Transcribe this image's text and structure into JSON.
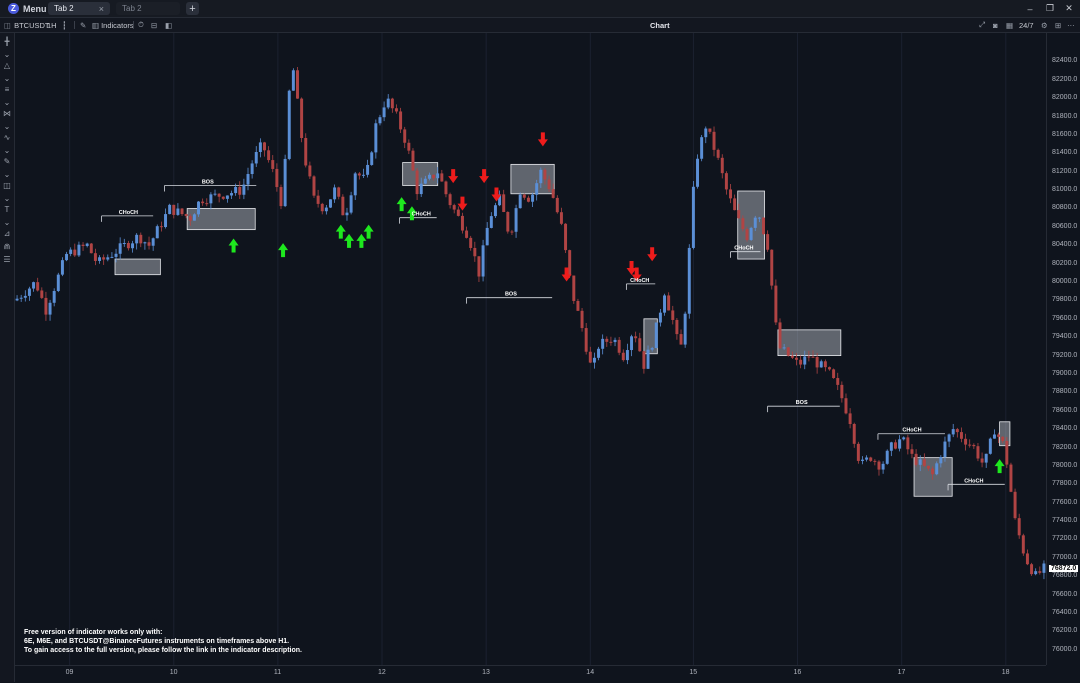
{
  "topbar": {
    "menu_label": "Menu",
    "logo_text": "Z",
    "tabs": [
      {
        "label": "Tab 2",
        "active": true
      },
      {
        "label": "Tab 2",
        "active": false
      }
    ],
    "add_tab_label": "+",
    "window_buttons": {
      "minimize": "–",
      "restore": "❐",
      "close": "✕"
    }
  },
  "toolbar": {
    "symbol": "BTCUSDT",
    "interval": "1H",
    "indicators_label": "Indicators",
    "center_title": "Chart",
    "session_label": "24/7"
  },
  "sidebar_icons": [
    "crosshair-icon",
    "chevron-down-icon",
    "triangle-tool-icon",
    "chevron-down-icon",
    "lines-tool-icon",
    "chevron-down-icon",
    "pattern-tool-icon",
    "chevron-down-icon",
    "curve-tool-icon",
    "chevron-down-icon",
    "brush-tool-icon",
    "chevron-down-icon",
    "shapes-tool-icon",
    "chevron-down-icon",
    "text-tool-icon",
    "chevron-down-icon",
    "measure-tool-icon",
    "magnet-icon",
    "layers-icon"
  ],
  "notice": [
    "Free version of indicator works only with:",
    "6E, M6E, and BTCUSDT@BinanceFutures instruments on timeframes above H1.",
    "To gain access to the full version, please follow the link in the indicator description."
  ],
  "chart_data": {
    "type": "candlestick",
    "symbol": "BTCUSDT",
    "timeframe": "1H",
    "ylim": [
      75900,
      82600
    ],
    "yticks": [
      82400,
      82200,
      82000,
      81800,
      81600,
      81400,
      81200,
      81000,
      80800,
      80600,
      80400,
      80200,
      80000,
      79800,
      79600,
      79400,
      79200,
      79000,
      78800,
      78600,
      78400,
      78200,
      78000,
      77800,
      77600,
      77400,
      77200,
      77000,
      76800,
      76600,
      76400,
      76200,
      76000
    ],
    "ytick_labels": [
      "82400.0",
      "82200.0",
      "82000.0",
      "81800.0",
      "81600.0",
      "81400.0",
      "81200.0",
      "81000.0",
      "80800.0",
      "80600.0",
      "80400.0",
      "80200.0",
      "80000.0",
      "79800.0",
      "79600.0",
      "79400.0",
      "79200.0",
      "79000.0",
      "78800.0",
      "78600.0",
      "78400.0",
      "78200.0",
      "78000.0",
      "77800.0",
      "77600.0",
      "77400.0",
      "77200.0",
      "77000.0",
      "76800.0",
      "76600.0",
      "76400.0",
      "76200.0",
      "76000.0"
    ],
    "xlim": [
      0,
      100
    ],
    "xticks": [
      {
        "label": "09",
        "x": 5.3
      },
      {
        "label": "10",
        "x": 15.4
      },
      {
        "label": "11",
        "x": 25.5
      },
      {
        "label": "12",
        "x": 35.6
      },
      {
        "label": "13",
        "x": 45.7
      },
      {
        "label": "14",
        "x": 55.8
      },
      {
        "label": "15",
        "x": 65.8
      },
      {
        "label": "16",
        "x": 75.9
      },
      {
        "label": "17",
        "x": 86.0
      },
      {
        "label": "18",
        "x": 96.1
      }
    ],
    "last_price": "76872.0",
    "up_color": "#5b8fd6",
    "down_color": "#b04444",
    "price_path": [
      [
        0,
        79800
      ],
      [
        2,
        80000
      ],
      [
        3,
        79700
      ],
      [
        5,
        80300
      ],
      [
        7,
        80400
      ],
      [
        8,
        80200
      ],
      [
        10,
        80350
      ],
      [
        12,
        80500
      ],
      [
        13,
        80400
      ],
      [
        14,
        80600
      ],
      [
        15,
        80800
      ],
      [
        17,
        80700
      ],
      [
        18,
        80900
      ],
      [
        20,
        80950
      ],
      [
        22,
        81000
      ],
      [
        23,
        81300
      ],
      [
        24,
        81500
      ],
      [
        25,
        81200
      ],
      [
        26,
        80800
      ],
      [
        26.5,
        82000
      ],
      [
        27,
        82300
      ],
      [
        28,
        81400
      ],
      [
        29,
        80900
      ],
      [
        30,
        80800
      ],
      [
        31,
        81000
      ],
      [
        32,
        80700
      ],
      [
        33,
        81200
      ],
      [
        34,
        81100
      ],
      [
        35,
        81700
      ],
      [
        36,
        82000
      ],
      [
        37,
        81800
      ],
      [
        38,
        81500
      ],
      [
        39,
        81000
      ],
      [
        40,
        81100
      ],
      [
        41,
        81200
      ],
      [
        42,
        80900
      ],
      [
        43,
        80700
      ],
      [
        44,
        80500
      ],
      [
        45,
        80100
      ],
      [
        46,
        80700
      ],
      [
        47,
        80900
      ],
      [
        48,
        80500
      ],
      [
        49,
        81000
      ],
      [
        50,
        80900
      ],
      [
        51,
        81200
      ],
      [
        52,
        81000
      ],
      [
        53,
        80600
      ],
      [
        54,
        79900
      ],
      [
        55,
        79500
      ],
      [
        56,
        79000
      ],
      [
        56.5,
        79300
      ],
      [
        58,
        79400
      ],
      [
        59,
        79200
      ],
      [
        60,
        79500
      ],
      [
        61,
        79100
      ],
      [
        62,
        79400
      ],
      [
        63,
        79900
      ],
      [
        64,
        79500
      ],
      [
        64.5,
        79200
      ],
      [
        65,
        79700
      ],
      [
        66,
        81300
      ],
      [
        67,
        81700
      ],
      [
        68,
        81400
      ],
      [
        69,
        81000
      ],
      [
        70,
        80700
      ],
      [
        71,
        80500
      ],
      [
        72,
        80800
      ],
      [
        73,
        80400
      ],
      [
        74,
        79300
      ],
      [
        75,
        79200
      ],
      [
        76,
        79100
      ],
      [
        77,
        79200
      ],
      [
        78,
        79100
      ],
      [
        79,
        79000
      ],
      [
        80,
        78800
      ],
      [
        81,
        78500
      ],
      [
        82,
        78000
      ],
      [
        83,
        78100
      ],
      [
        84,
        78000
      ],
      [
        85,
        78200
      ],
      [
        86,
        78300
      ],
      [
        87,
        78100
      ],
      [
        88,
        78000
      ],
      [
        89,
        77900
      ],
      [
        90,
        78200
      ],
      [
        91,
        78400
      ],
      [
        92,
        78300
      ],
      [
        93,
        78200
      ],
      [
        94,
        78000
      ],
      [
        95,
        78400
      ],
      [
        96,
        78200
      ],
      [
        97,
        77400
      ],
      [
        98,
        77000
      ],
      [
        99,
        76800
      ],
      [
        100,
        76900
      ]
    ],
    "markers": {
      "buy": [
        [
          26,
          80500
        ],
        [
          31.6,
          80700
        ],
        [
          32.4,
          80600
        ],
        [
          33.6,
          80600
        ],
        [
          34.3,
          80700
        ],
        [
          37.5,
          81000
        ],
        [
          38.5,
          80900
        ],
        [
          21.2,
          80550
        ],
        [
          95.5,
          78150
        ]
      ],
      "sell": [
        [
          42.5,
          81000
        ],
        [
          43.4,
          80700
        ],
        [
          45.5,
          81000
        ],
        [
          46.7,
          80800
        ],
        [
          51.2,
          81400
        ],
        [
          53.5,
          79930
        ],
        [
          59.8,
          80000
        ],
        [
          60.3,
          79930
        ],
        [
          61.8,
          80150
        ]
      ]
    },
    "boxes": [
      {
        "x0": 9.7,
        "x1": 14.1,
        "y0": 80250,
        "y1": 80080,
        "label": ""
      },
      {
        "x0": 16.7,
        "x1": 23.3,
        "y0": 80800,
        "y1": 80570,
        "label": ""
      },
      {
        "x0": 37.6,
        "x1": 41.0,
        "y0": 81300,
        "y1": 81050,
        "label": ""
      },
      {
        "x0": 48.1,
        "x1": 52.3,
        "y0": 81280,
        "y1": 80960,
        "label": ""
      },
      {
        "x0": 61.0,
        "x1": 62.3,
        "y0": 79600,
        "y1": 79220,
        "label": ""
      },
      {
        "x0": 70.1,
        "x1": 72.7,
        "y0": 80990,
        "y1": 80250,
        "label": ""
      },
      {
        "x0": 74.0,
        "x1": 80.1,
        "y0": 79480,
        "y1": 79200,
        "label": ""
      },
      {
        "x0": 87.2,
        "x1": 90.9,
        "y0": 78090,
        "y1": 77670,
        "label": ""
      },
      {
        "x0": 95.5,
        "x1": 96.5,
        "y0": 78480,
        "y1": 78220,
        "label": ""
      }
    ],
    "structure_lines": [
      {
        "x0": 8.4,
        "x1": 13.4,
        "y": 80720,
        "label": "CHoCH",
        "label_x": 11.0
      },
      {
        "x0": 14.5,
        "x1": 23.4,
        "y": 81050,
        "label": "BOS",
        "label_x": 18.7
      },
      {
        "x0": 37.3,
        "x1": 40.9,
        "y": 80700,
        "label": "CHoCH",
        "label_x": 39.4
      },
      {
        "x0": 43.8,
        "x1": 52.1,
        "y": 79830,
        "label": "BOS",
        "label_x": 48.1
      },
      {
        "x0": 59.3,
        "x1": 62.1,
        "y": 79980,
        "label": "CHoCH",
        "label_x": 60.6
      },
      {
        "x0": 69.4,
        "x1": 72.3,
        "y": 80330,
        "label": "CHoCH",
        "label_x": 70.7
      },
      {
        "x0": 73.0,
        "x1": 80.0,
        "y": 78650,
        "label": "BOS",
        "label_x": 76.3
      },
      {
        "x0": 83.7,
        "x1": 90.2,
        "y": 78350,
        "label": "CHoCH",
        "label_x": 87.0
      },
      {
        "x0": 90.5,
        "x1": 96.0,
        "y": 77800,
        "label": "CHoCH",
        "label_x": 93.0
      }
    ]
  }
}
